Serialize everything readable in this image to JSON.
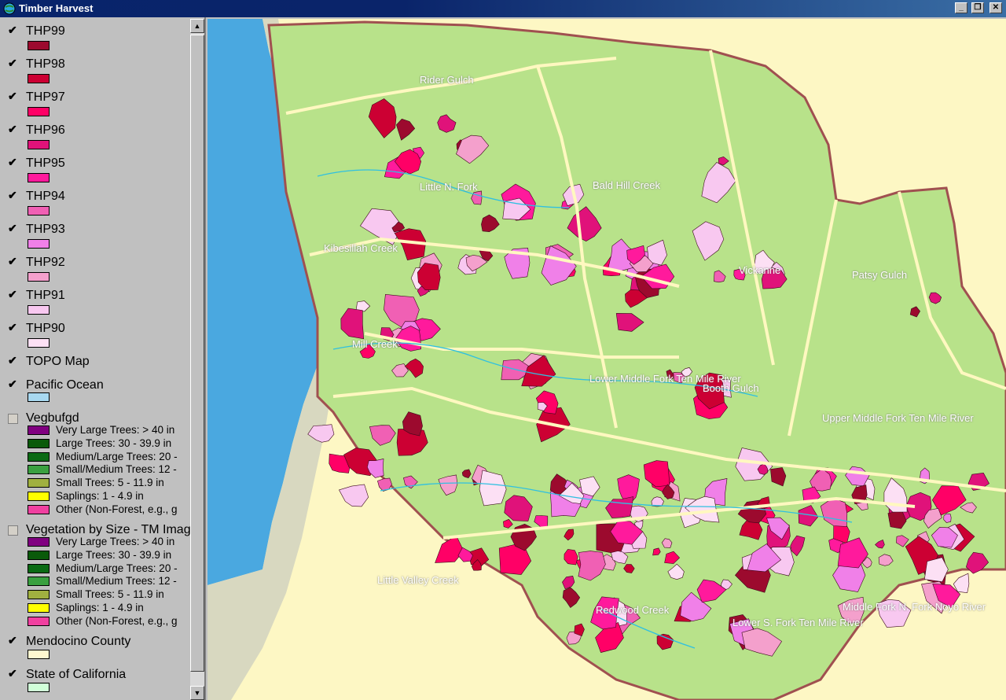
{
  "window": {
    "title": "Timber Harvest"
  },
  "toc": {
    "thp_layers": [
      {
        "name": "THP99",
        "color": "#9c0a2e",
        "checked": true
      },
      {
        "name": "THP98",
        "color": "#cc0033",
        "checked": true
      },
      {
        "name": "THP97",
        "color": "#ff0066",
        "checked": true
      },
      {
        "name": "THP96",
        "color": "#e0127a",
        "checked": true
      },
      {
        "name": "THP95",
        "color": "#ff1a9c",
        "checked": true
      },
      {
        "name": "THP94",
        "color": "#f060b4",
        "checked": true
      },
      {
        "name": "THP93",
        "color": "#f080e8",
        "checked": true
      },
      {
        "name": "THP92",
        "color": "#f4a0cc",
        "checked": true
      },
      {
        "name": "THP91",
        "color": "#f8c8f0",
        "checked": true
      },
      {
        "name": "THP90",
        "color": "#fce0f4",
        "checked": true
      }
    ],
    "topo": {
      "name": "TOPO Map",
      "checked": true
    },
    "ocean": {
      "name": "Pacific Ocean",
      "color": "#a8d8f0",
      "checked": true
    },
    "vegbufgd": {
      "name": "Vegbufgd",
      "checked": false,
      "classes": [
        {
          "label": "Very Large Trees: > 40  in",
          "color": "#800080"
        },
        {
          "label": "Large Trees: 30 - 39.9 in",
          "color": "#0a5a0a"
        },
        {
          "label": "Medium/Large Trees: 20 -",
          "color": "#0a6a14"
        },
        {
          "label": "Small/Medium Trees: 12 -",
          "color": "#3aa040"
        },
        {
          "label": "Small Trees: 5 - 11.9 in",
          "color": "#a0b040"
        },
        {
          "label": "Saplings: 1 - 4.9 in",
          "color": "#ffff00"
        },
        {
          "label": "Other (Non-Forest, e.g., g",
          "color": "#f040a0"
        }
      ]
    },
    "vegtm": {
      "name": "Vegetation by Size - TM Image",
      "checked": false,
      "classes": [
        {
          "label": "Very Large Trees: > 40  in",
          "color": "#800080"
        },
        {
          "label": "Large Trees: 30 - 39.9 in",
          "color": "#0a5a0a"
        },
        {
          "label": "Medium/Large Trees: 20 -",
          "color": "#0a6a14"
        },
        {
          "label": "Small/Medium Trees: 12 -",
          "color": "#3aa040"
        },
        {
          "label": "Small Trees: 5 - 11.9 in",
          "color": "#a0b040"
        },
        {
          "label": "Saplings: 1 - 4.9 in",
          "color": "#ffff00"
        },
        {
          "label": "Other (Non-Forest, e.g., g",
          "color": "#f040a0"
        }
      ]
    },
    "county": {
      "name": "Mendocino County",
      "color": "#fff8d0",
      "checked": true
    },
    "state": {
      "name": "State of California",
      "color": "#d0ffd8",
      "checked": true
    }
  },
  "map": {
    "labels": [
      "Rider Gulch",
      "Bald Hill Creek",
      "Little N. Fork",
      "Kibesillah Creek",
      "Vickanne",
      "Patsy Gulch",
      "Mill Creek",
      "Lower Middle Fork Ten Mile River",
      "Booth Gulch",
      "Upper Middle Fork Ten Mile River",
      "Little Valley Creek",
      "Middle Fork N. Fork Noyo River",
      "Lower S. Fork Ten Mile River",
      "Redwood Creek"
    ]
  }
}
